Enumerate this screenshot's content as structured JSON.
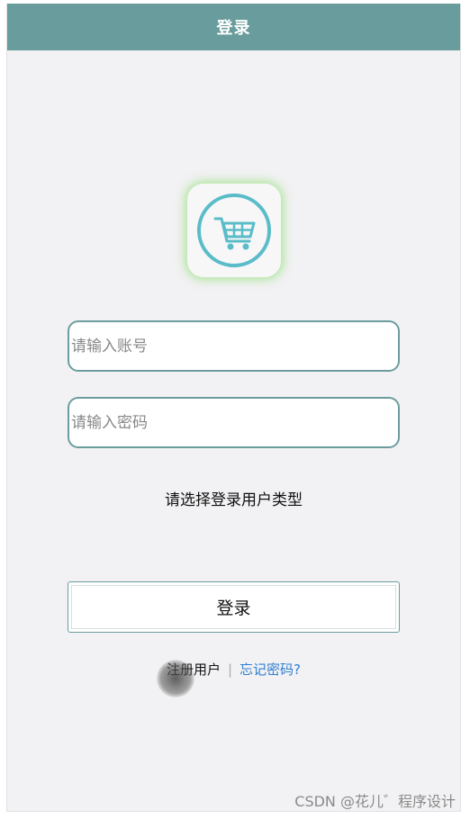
{
  "header": {
    "title": "登录"
  },
  "logo": {
    "icon": "shopping-cart-icon",
    "color": "#5bbcc9"
  },
  "form": {
    "account_placeholder": "请输入账号",
    "password_placeholder": "请输入密码",
    "account_value": "",
    "password_value": "",
    "user_type_prompt": "请选择登录用户类型",
    "login_label": "登录"
  },
  "links": {
    "register": "注册用户",
    "separator": "|",
    "forgot_password": "忘记密码?"
  },
  "watermark": "CSDN @花儿゛程序设计",
  "colors": {
    "header_bg": "#699c9c",
    "page_bg": "#f2f1f3",
    "input_border": "#6c9d9e",
    "link": "#2f7fd1",
    "logo_glow": "#78dc5a"
  }
}
